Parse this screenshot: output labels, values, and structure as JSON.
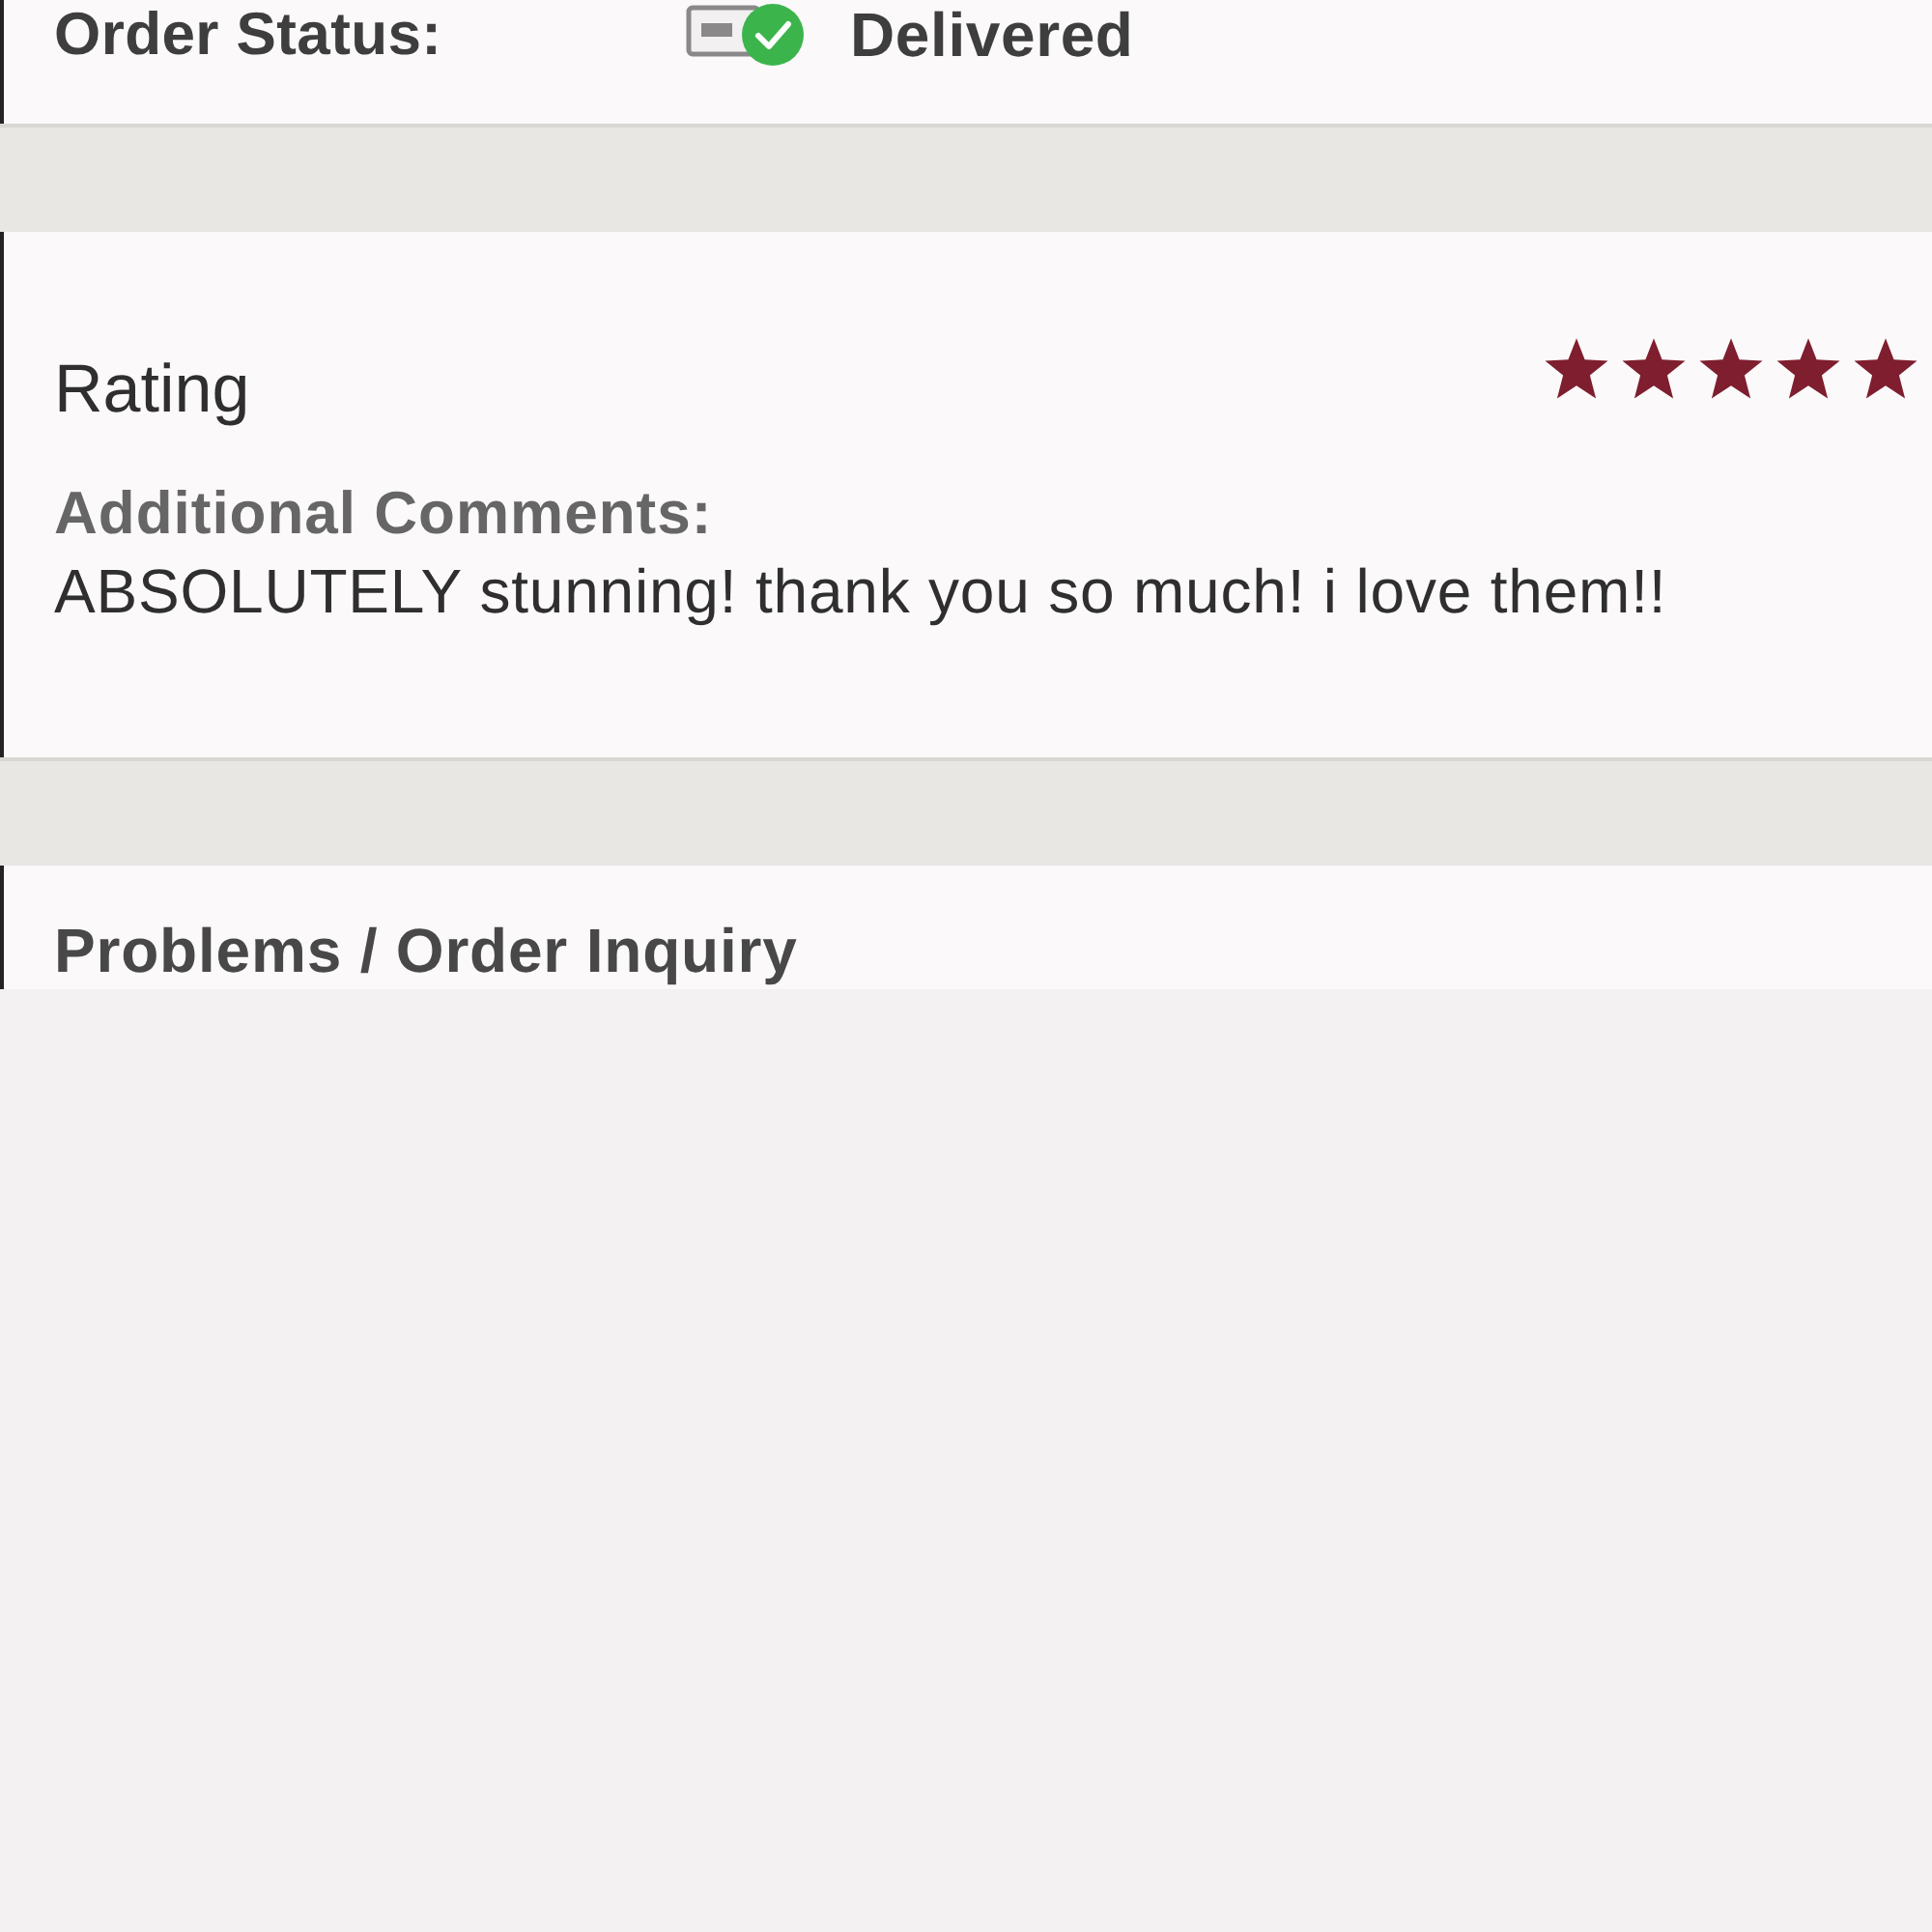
{
  "order_status": {
    "label": "Order Status:",
    "value": "Delivered"
  },
  "rating": {
    "title": "Rating",
    "stars": 5,
    "comments_label": "Additional Comments:",
    "comment": "ABSOLUTELY stunning! thank you so much! i love them!!"
  },
  "problems": {
    "title": "Problems / Order Inquiry"
  }
}
